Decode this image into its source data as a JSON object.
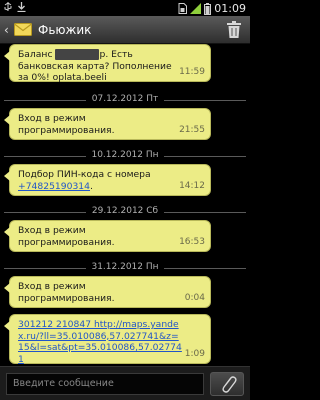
{
  "status_bar": {
    "time": "01:09",
    "icons": [
      "usb-icon",
      "download-icon",
      "sim-icon",
      "signal-icon",
      "battery-icon"
    ]
  },
  "header": {
    "contact_name": "Фьюжик",
    "icons": [
      "back-arrow-icon",
      "envelope-icon",
      "trash-icon"
    ]
  },
  "messages": [
    {
      "type": "message",
      "lines": [
        "Баланс ",
        "р. Есть банковская карта? Пополнение за 0%! oplata.beeli"
      ],
      "time": "11:59",
      "redacted": true
    },
    {
      "type": "date",
      "label": "07.12.2012 Пт"
    },
    {
      "type": "message",
      "text": "Вход в режим программирования.",
      "time": "21:55"
    },
    {
      "type": "date",
      "label": "10.12.2012 Пн"
    },
    {
      "type": "message",
      "text": "Подбор ПИН-кода с номера",
      "link": "+74825190314",
      "suffix": ".",
      "time": "14:12"
    },
    {
      "type": "date",
      "label": "29.12.2012 Сб"
    },
    {
      "type": "message",
      "text": "Вход в режим программирования.",
      "time": "16:53"
    },
    {
      "type": "date",
      "label": "31.12.2012 Пн"
    },
    {
      "type": "message",
      "text": "Вход в режим программирования.",
      "time": "0:04"
    },
    {
      "type": "message",
      "link": "301212 210847 http://maps.yandex.ru/?ll=35.010086,57.027741&z=15&l=sat&pt=35.010086,57.027741",
      "time": "1:09"
    }
  ],
  "compose": {
    "placeholder": "Введите сообщение",
    "attach_icon": "paperclip-icon"
  },
  "colors": {
    "bubble": "#ecec86",
    "link": "#2256c8",
    "background": "#000000"
  }
}
